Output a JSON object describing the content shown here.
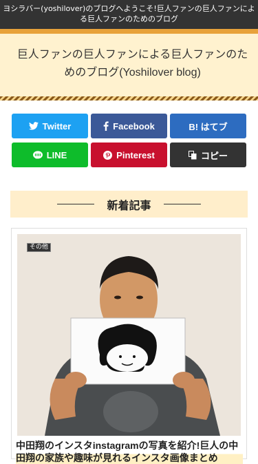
{
  "topbar": {
    "text": "ヨシラバー(yoshilover)のブログへようこそ!巨人ファンの巨人ファンによる巨人ファンのためのブログ"
  },
  "header": {
    "site_title": "巨人ファンの巨人ファンによる巨人ファンのためのブログ(Yoshilover blog)"
  },
  "share": {
    "twitter": "Twitter",
    "facebook": "Facebook",
    "hatena": "B! はてブ",
    "line": "LINE",
    "pinterest": "Pinterest",
    "copy": "コピー"
  },
  "section": {
    "title": "新着記事"
  },
  "card": {
    "category": "その他",
    "title": "中田翔のインスタinstagramの写真を紹介!巨人の中田翔の家族や趣味が見れるインスタ画像まとめ"
  },
  "colors": {
    "topbar": "#333333",
    "accent": "#e8a23a",
    "header_bg": "#fff2cf",
    "twitter": "#1da1f2",
    "facebook": "#3b5998",
    "hatena": "#2d6cc0",
    "line": "#0ebc2b",
    "pinterest": "#c8102e",
    "copy": "#333333"
  }
}
